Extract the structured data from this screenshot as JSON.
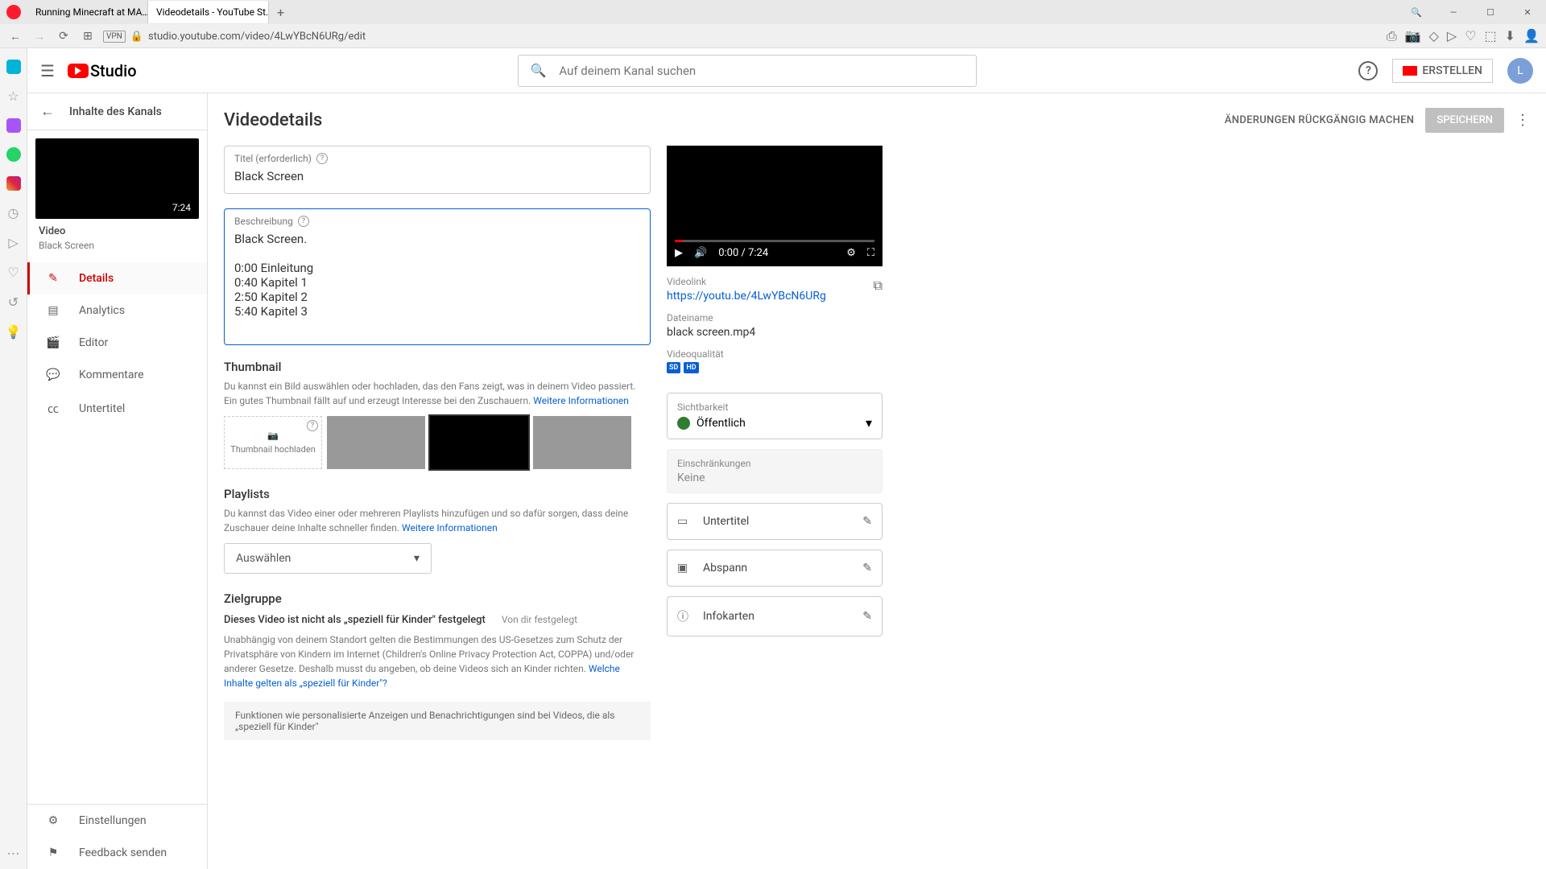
{
  "browser": {
    "tabs": [
      {
        "title": "Running Minecraft at MA…",
        "active": false
      },
      {
        "title": "Videodetails - YouTube St…",
        "active": true
      }
    ],
    "url": "studio.youtube.com/video/4LwYBcN6URg/edit",
    "vpn": "VPN"
  },
  "topbar": {
    "logo": "Studio",
    "search_placeholder": "Auf deinem Kanal suchen",
    "create": "ERSTELLEN",
    "avatar": "L"
  },
  "sidebar": {
    "back": "Inhalte des Kanals",
    "duration": "7:24",
    "video_label": "Video",
    "video_name": "Black Screen",
    "nav": [
      {
        "label": "Details",
        "icon": "✎",
        "active": true
      },
      {
        "label": "Analytics",
        "icon": "▤",
        "active": false
      },
      {
        "label": "Editor",
        "icon": "🎬",
        "active": false
      },
      {
        "label": "Kommentare",
        "icon": "💬",
        "active": false
      },
      {
        "label": "Untertitel",
        "icon": "㏄",
        "active": false
      }
    ],
    "bottom": [
      {
        "label": "Einstellungen",
        "icon": "⚙"
      },
      {
        "label": "Feedback senden",
        "icon": "⚑"
      }
    ]
  },
  "page": {
    "title": "Videodetails",
    "undo": "ÄNDERUNGEN RÜCKGÄNGIG MACHEN",
    "save": "SPEICHERN"
  },
  "title_field": {
    "label": "Titel (erforderlich)",
    "value": "Black Screen"
  },
  "desc_field": {
    "label": "Beschreibung",
    "value": "Black Screen.\n\n0:00 Einleitung\n0:40 Kapitel 1\n2:50 Kapitel 2\n5:40 Kapitel 3"
  },
  "thumbnail": {
    "heading": "Thumbnail",
    "desc": "Du kannst ein Bild auswählen oder hochladen, das den Fans zeigt, was in deinem Video passiert. Ein gutes Thumbnail fällt auf und erzeugt Interesse bei den Zuschauern. ",
    "more": "Weitere Informationen",
    "upload": "Thumbnail hochladen"
  },
  "playlists": {
    "heading": "Playlists",
    "desc": "Du kannst das Video einer oder mehreren Playlists hinzufügen und so dafür sorgen, dass deine Zuschauer deine Inhalte schneller finden. ",
    "more": "Weitere Informationen",
    "select": "Auswählen"
  },
  "audience": {
    "heading": "Zielgruppe",
    "bold": "Dieses Video ist nicht als „speziell für Kinder\" festgelegt",
    "tag": "Von dir festgelegt",
    "para": "Unabhängig von deinem Standort gelten die Bestimmungen des US-Gesetzes zum Schutz der Privatsphäre von Kindern im Internet (Children's Online Privacy Protection Act, COPPA) und/oder anderer Gesetze. Deshalb musst du angeben, ob deine Videos sich an Kinder richten. ",
    "link": "Welche Inhalte gelten als „speziell für Kinder\"?",
    "strip": "Funktionen wie personalisierte Anzeigen und Benachrichtigungen sind bei Videos, die als „speziell für Kinder\""
  },
  "player": {
    "time": "0:00 / 7:24"
  },
  "meta": {
    "link_label": "Videolink",
    "link": "https://youtu.be/4LwYBcN6URg",
    "file_label": "Dateiname",
    "file": "black screen.mp4",
    "quality_label": "Videoqualität",
    "sd": "SD",
    "hd": "HD"
  },
  "visibility": {
    "label": "Sichtbarkeit",
    "value": "Öffentlich"
  },
  "restrictions": {
    "label": "Einschränkungen",
    "value": "Keine"
  },
  "rows": {
    "subtitles": "Untertitel",
    "endscreen": "Abspann",
    "cards": "Infokarten"
  }
}
